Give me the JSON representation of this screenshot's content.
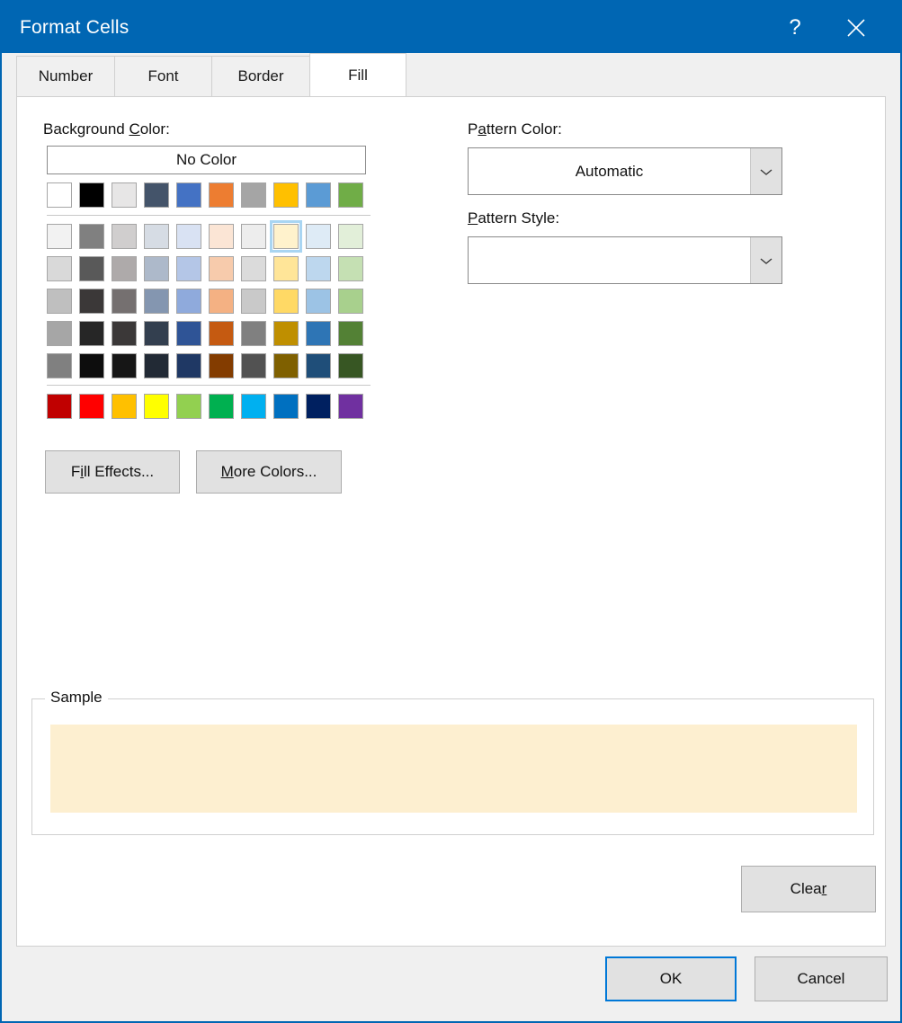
{
  "window": {
    "title": "Format Cells",
    "help_icon": "question-mark-icon",
    "close_icon": "close-icon"
  },
  "tabs": [
    {
      "id": "number",
      "label": "Number",
      "active": false
    },
    {
      "id": "font",
      "label": "Font",
      "active": false
    },
    {
      "id": "border",
      "label": "Border",
      "active": false
    },
    {
      "id": "fill",
      "label": "Fill",
      "active": true
    }
  ],
  "fill_tab": {
    "background_color": {
      "label_pre": "Background ",
      "label_accel": "C",
      "label_post": "olor:",
      "no_color_label": "No Color",
      "theme_colors": [
        "#FFFFFF",
        "#000000",
        "#E7E6E6",
        "#44546A",
        "#4472C4",
        "#ED7D31",
        "#A5A5A5",
        "#FFC000",
        "#5B9BD5",
        "#70AD47"
      ],
      "tint_rows": [
        [
          "#F2F2F2",
          "#808080",
          "#D0CECE",
          "#D6DCE4",
          "#D9E2F3",
          "#FBE5D5",
          "#EDEDED",
          "#FFF2CC",
          "#DEEBF6",
          "#E2EFD9"
        ],
        [
          "#D9D9D9",
          "#595959",
          "#AEAAAA",
          "#ADB9CA",
          "#B4C6E7",
          "#F7CBAC",
          "#DBDBDB",
          "#FFE598",
          "#BDD7EE",
          "#C5E0B3"
        ],
        [
          "#BFBFBF",
          "#3B3838",
          "#757070",
          "#8496B0",
          "#8FAADC",
          "#F4B183",
          "#C9C9C9",
          "#FFD965",
          "#9CC3E5",
          "#A8D08D"
        ],
        [
          "#A6A6A6",
          "#262626",
          "#3B3838",
          "#333F4F",
          "#2F5496",
          "#C55A11",
          "#808080",
          "#BF8F00",
          "#2E75B5",
          "#538135"
        ],
        [
          "#808080",
          "#0D0D0D",
          "#161616",
          "#222A35",
          "#1F3864",
          "#833C00",
          "#525252",
          "#7F6000",
          "#1F4E79",
          "#375623"
        ]
      ],
      "standard_colors": [
        "#C00000",
        "#FF0000",
        "#FFC000",
        "#FFFF00",
        "#92D050",
        "#00B050",
        "#00B0F0",
        "#0070C0",
        "#002060",
        "#7030A0"
      ],
      "selected_swatch": {
        "row": 0,
        "col": 7,
        "hex": "#FFF2CC"
      }
    },
    "fill_effects_button": {
      "pre": "F",
      "accel": "i",
      "post": "ll Effects..."
    },
    "more_colors_button": {
      "pre": "",
      "accel": "M",
      "post": "ore Colors..."
    },
    "pattern_color": {
      "label_pre": "P",
      "label_accel": "a",
      "label_post": "ttern Color:",
      "value": "Automatic",
      "arrow_icon": "chevron-down-icon"
    },
    "pattern_style": {
      "label_pre": "",
      "label_accel": "P",
      "label_post": "attern Style:",
      "value": "",
      "arrow_icon": "chevron-down-icon"
    },
    "sample": {
      "legend": "Sample",
      "fill_hex": "#FDEFD0"
    },
    "clear_button": {
      "pre": "Clea",
      "accel": "r",
      "post": ""
    }
  },
  "footer": {
    "ok_label": "OK",
    "cancel_label": "Cancel"
  },
  "theme": {
    "title_bar_bg": "#0066B3",
    "dialog_border": "#0066B3",
    "focus_border": "#0078D7",
    "selection_ring": "#A9D5F2",
    "button_face": "#E1E1E1",
    "dialog_face": "#F0F0F0"
  }
}
